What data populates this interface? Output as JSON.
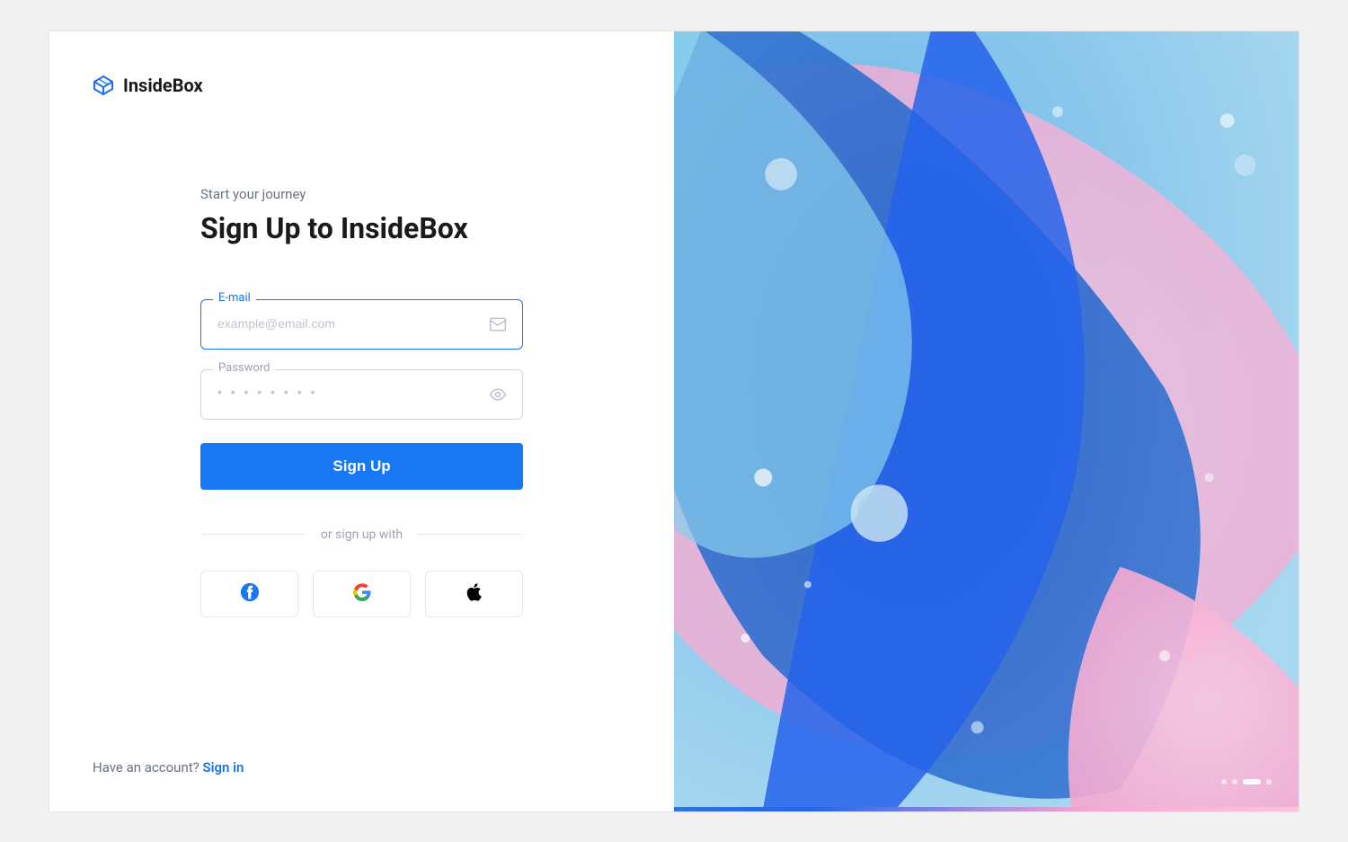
{
  "brand": {
    "name": "InsideBox"
  },
  "header": {
    "subtitle": "Start your journey",
    "title": "Sign Up to InsideBox"
  },
  "form": {
    "email": {
      "label": "E-mail",
      "placeholder": "example@email.com",
      "value": ""
    },
    "password": {
      "label": "Password",
      "placeholder": "• • • • • • • •",
      "value": ""
    },
    "submit_label": "Sign Up"
  },
  "divider_text": "or sign up with",
  "social": {
    "facebook": "Facebook",
    "google": "Google",
    "apple": "Apple"
  },
  "footer": {
    "prompt": "Have an account? ",
    "link_text": "Sign in"
  }
}
